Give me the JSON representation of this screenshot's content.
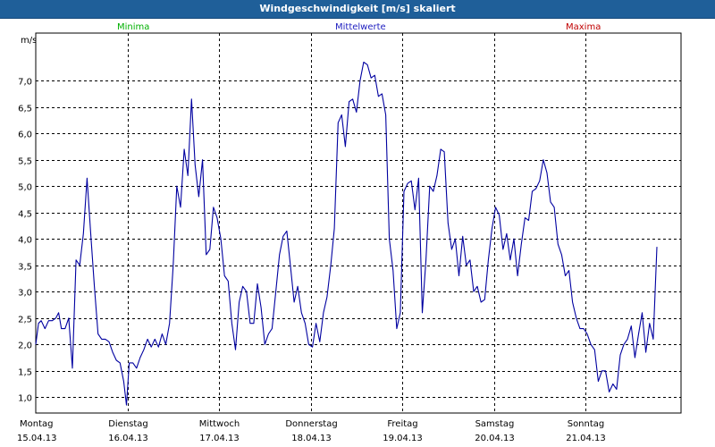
{
  "header": {
    "title": "Windgeschwindigkeit [m/s] skaliert"
  },
  "legend": {
    "minima": "Minima",
    "mittelwerte": "Mittelwerte",
    "maxima": "Maxima",
    "minima_color": "#00b000",
    "mittelwerte_color": "#2020c0",
    "maxima_color": "#c00000"
  },
  "chart_data": {
    "type": "line",
    "title": "Windgeschwindigkeit [m/s] skaliert",
    "ylabel": "m/s",
    "ylim": [
      0.7,
      7.9
    ],
    "yticks": [
      "1,0",
      "1,5",
      "2,0",
      "2,5",
      "3,0",
      "3,5",
      "4,0",
      "4,5",
      "5,0",
      "5,5",
      "6,0",
      "6,5",
      "7,0"
    ],
    "grid": true,
    "line_color": "#0000a0",
    "days": [
      {
        "day": "Montag",
        "date": "15.04.13"
      },
      {
        "day": "Dienstag",
        "date": "16.04.13"
      },
      {
        "day": "Mittwoch",
        "date": "17.04.13"
      },
      {
        "day": "Donnerstag",
        "date": "18.04.13"
      },
      {
        "day": "Freitag",
        "date": "19.04.13"
      },
      {
        "day": "Samstag",
        "date": "20.04.13"
      },
      {
        "day": "Sonntag",
        "date": "21.04.13"
      }
    ],
    "series": [
      {
        "x_unit": "days since 15.04.13 00:00",
        "points": [
          [
            0.0,
            2.0
          ],
          [
            0.03,
            2.4
          ],
          [
            0.06,
            2.45
          ],
          [
            0.1,
            2.3
          ],
          [
            0.14,
            2.45
          ],
          [
            0.18,
            2.45
          ],
          [
            0.22,
            2.5
          ],
          [
            0.25,
            2.6
          ],
          [
            0.28,
            2.3
          ],
          [
            0.32,
            2.3
          ],
          [
            0.36,
            2.5
          ],
          [
            0.4,
            1.55
          ],
          [
            0.44,
            3.6
          ],
          [
            0.48,
            3.5
          ],
          [
            0.52,
            4.1
          ],
          [
            0.56,
            5.15
          ],
          [
            0.6,
            4.1
          ],
          [
            0.64,
            3.1
          ],
          [
            0.68,
            2.2
          ],
          [
            0.72,
            2.1
          ],
          [
            0.76,
            2.1
          ],
          [
            0.8,
            2.05
          ],
          [
            0.84,
            1.85
          ],
          [
            0.88,
            1.7
          ],
          [
            0.92,
            1.65
          ],
          [
            0.96,
            1.3
          ],
          [
            0.99,
            0.85
          ],
          [
            1.02,
            1.65
          ],
          [
            1.06,
            1.65
          ],
          [
            1.1,
            1.55
          ],
          [
            1.14,
            1.75
          ],
          [
            1.18,
            1.9
          ],
          [
            1.22,
            2.1
          ],
          [
            1.26,
            1.95
          ],
          [
            1.3,
            2.1
          ],
          [
            1.34,
            1.95
          ],
          [
            1.38,
            2.2
          ],
          [
            1.42,
            2.0
          ],
          [
            1.46,
            2.4
          ],
          [
            1.5,
            3.5
          ],
          [
            1.54,
            5.0
          ],
          [
            1.58,
            4.6
          ],
          [
            1.62,
            5.7
          ],
          [
            1.66,
            5.2
          ],
          [
            1.7,
            6.65
          ],
          [
            1.74,
            5.4
          ],
          [
            1.78,
            4.8
          ],
          [
            1.82,
            5.5
          ],
          [
            1.86,
            3.7
          ],
          [
            1.9,
            3.8
          ],
          [
            1.94,
            4.6
          ],
          [
            1.98,
            4.4
          ],
          [
            2.02,
            4.0
          ],
          [
            2.06,
            3.3
          ],
          [
            2.1,
            3.2
          ],
          [
            2.14,
            2.4
          ],
          [
            2.18,
            1.9
          ],
          [
            2.22,
            2.8
          ],
          [
            2.26,
            3.1
          ],
          [
            2.3,
            3.0
          ],
          [
            2.34,
            2.4
          ],
          [
            2.38,
            2.4
          ],
          [
            2.42,
            3.15
          ],
          [
            2.46,
            2.7
          ],
          [
            2.5,
            2.0
          ],
          [
            2.54,
            2.2
          ],
          [
            2.58,
            2.3
          ],
          [
            2.62,
            3.0
          ],
          [
            2.66,
            3.7
          ],
          [
            2.7,
            4.05
          ],
          [
            2.74,
            4.15
          ],
          [
            2.78,
            3.5
          ],
          [
            2.82,
            2.8
          ],
          [
            2.86,
            3.1
          ],
          [
            2.9,
            2.6
          ],
          [
            2.94,
            2.4
          ],
          [
            2.98,
            2.0
          ],
          [
            3.02,
            1.95
          ],
          [
            3.06,
            2.4
          ],
          [
            3.1,
            2.05
          ],
          [
            3.14,
            2.6
          ],
          [
            3.18,
            2.9
          ],
          [
            3.22,
            3.5
          ],
          [
            3.26,
            4.2
          ],
          [
            3.3,
            6.2
          ],
          [
            3.34,
            6.35
          ],
          [
            3.38,
            5.75
          ],
          [
            3.42,
            6.6
          ],
          [
            3.46,
            6.65
          ],
          [
            3.5,
            6.4
          ],
          [
            3.54,
            7.0
          ],
          [
            3.58,
            7.35
          ],
          [
            3.62,
            7.3
          ],
          [
            3.66,
            7.05
          ],
          [
            3.7,
            7.1
          ],
          [
            3.74,
            6.7
          ],
          [
            3.78,
            6.75
          ],
          [
            3.82,
            6.35
          ],
          [
            3.86,
            4.0
          ],
          [
            3.9,
            3.4
          ],
          [
            3.94,
            2.3
          ],
          [
            3.98,
            2.6
          ],
          [
            4.02,
            4.9
          ],
          [
            4.06,
            5.05
          ],
          [
            4.1,
            5.1
          ],
          [
            4.14,
            4.55
          ],
          [
            4.18,
            5.15
          ],
          [
            4.22,
            2.6
          ],
          [
            4.26,
            3.6
          ],
          [
            4.3,
            5.0
          ],
          [
            4.34,
            4.9
          ],
          [
            4.38,
            5.2
          ],
          [
            4.42,
            5.7
          ],
          [
            4.46,
            5.65
          ],
          [
            4.5,
            4.3
          ],
          [
            4.54,
            3.8
          ],
          [
            4.58,
            4.0
          ],
          [
            4.62,
            3.3
          ],
          [
            4.66,
            4.05
          ],
          [
            4.7,
            3.5
          ],
          [
            4.74,
            3.6
          ],
          [
            4.78,
            3.0
          ],
          [
            4.82,
            3.1
          ],
          [
            4.86,
            2.8
          ],
          [
            4.9,
            2.85
          ],
          [
            4.94,
            3.6
          ],
          [
            4.98,
            4.2
          ],
          [
            5.02,
            4.6
          ],
          [
            5.06,
            4.45
          ],
          [
            5.1,
            3.8
          ],
          [
            5.14,
            4.1
          ],
          [
            5.18,
            3.6
          ],
          [
            5.22,
            4.0
          ],
          [
            5.26,
            3.3
          ],
          [
            5.3,
            3.9
          ],
          [
            5.34,
            4.4
          ],
          [
            5.38,
            4.35
          ],
          [
            5.42,
            4.9
          ],
          [
            5.46,
            4.95
          ],
          [
            5.5,
            5.1
          ],
          [
            5.54,
            5.5
          ],
          [
            5.58,
            5.25
          ],
          [
            5.62,
            4.7
          ],
          [
            5.66,
            4.6
          ],
          [
            5.7,
            3.9
          ],
          [
            5.74,
            3.7
          ],
          [
            5.78,
            3.3
          ],
          [
            5.82,
            3.4
          ],
          [
            5.86,
            2.8
          ],
          [
            5.9,
            2.5
          ],
          [
            5.94,
            2.3
          ],
          [
            5.98,
            2.3
          ],
          [
            6.02,
            2.2
          ],
          [
            6.06,
            2.0
          ],
          [
            6.1,
            1.9
          ],
          [
            6.14,
            1.3
          ],
          [
            6.18,
            1.5
          ],
          [
            6.22,
            1.5
          ],
          [
            6.26,
            1.1
          ],
          [
            6.3,
            1.25
          ],
          [
            6.34,
            1.15
          ],
          [
            6.38,
            1.8
          ],
          [
            6.42,
            2.0
          ],
          [
            6.46,
            2.1
          ],
          [
            6.5,
            2.35
          ],
          [
            6.54,
            1.75
          ],
          [
            6.58,
            2.2
          ],
          [
            6.62,
            2.6
          ],
          [
            6.66,
            1.85
          ],
          [
            6.7,
            2.4
          ],
          [
            6.74,
            2.1
          ],
          [
            6.78,
            3.85
          ]
        ]
      }
    ]
  }
}
